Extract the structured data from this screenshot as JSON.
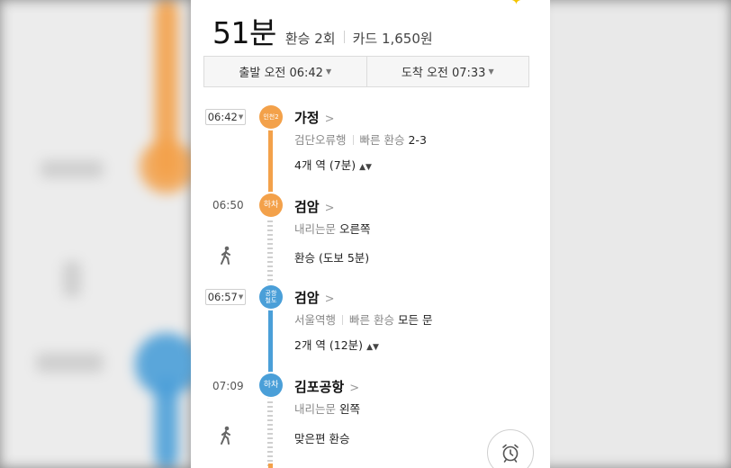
{
  "summary": {
    "total_time": "51분",
    "transfers": "환승 2회",
    "fare": "카드 1,650원"
  },
  "times": {
    "depart_label": "출발",
    "depart_value": "오전 06:42",
    "arrive_label": "도착",
    "arrive_value": "오전 07:33"
  },
  "colors": {
    "line_incheon2": "#f3a14a",
    "line_airport": "#4a9fd8",
    "walk_dash": "#cfcfcf"
  },
  "steps": [
    {
      "time": "06:42",
      "line_badge": "인천2",
      "station": "가정",
      "direction": "검단오류행",
      "transfer_label": "빠른 환승",
      "transfer_value": "2-3",
      "stops": "4개 역 (7분)"
    },
    {
      "time": "06:50",
      "badge": "하차",
      "station": "검암",
      "door_label": "내리는문",
      "door_value": "오른쪽"
    },
    {
      "walk": "환승 (도보 5분)"
    },
    {
      "time": "06:57",
      "line_badge": "공항철도",
      "station": "검암",
      "direction": "서울역행",
      "transfer_label": "빠른 환승",
      "transfer_value": "모든 문",
      "stops": "2개 역 (12분)"
    },
    {
      "time": "07:09",
      "badge": "하차",
      "station": "김포공항",
      "door_label": "내리는문",
      "door_value": "왼쪽"
    },
    {
      "walk": "맞은편 환승"
    }
  ],
  "icons": {
    "walk": "walking-person-icon",
    "alarm": "alarm-clock-icon",
    "chevron": "chevron-right-icon",
    "caret": "caret-down-icon",
    "updown": "up-down-arrow-icon",
    "star": "star-icon"
  }
}
